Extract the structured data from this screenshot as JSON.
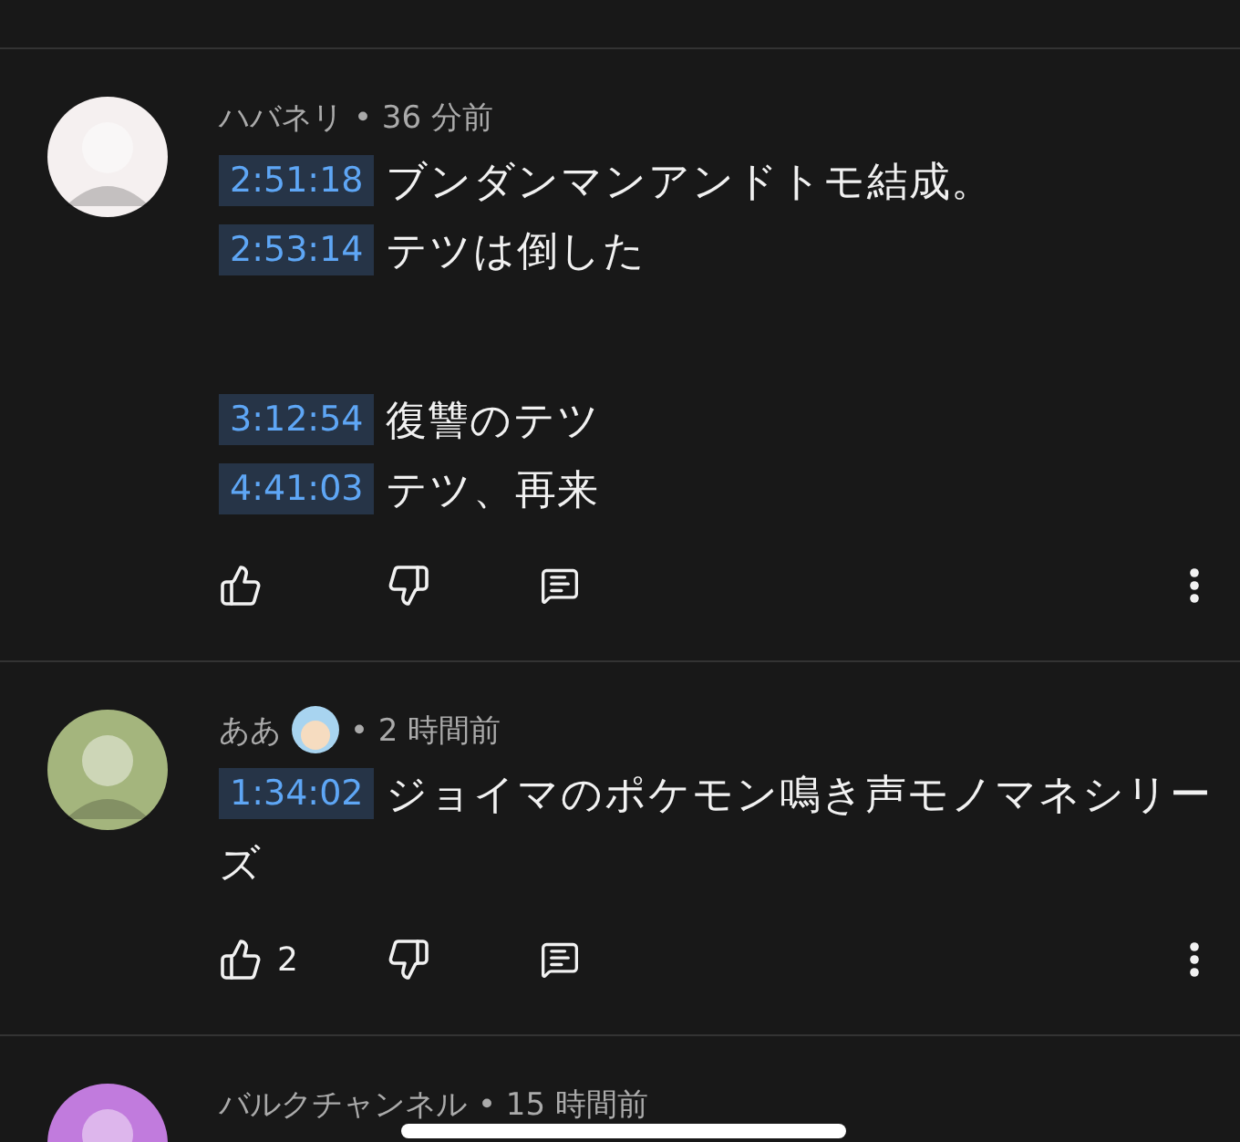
{
  "comments": [
    {
      "author": "ハバネリ",
      "time": "• 36 分前",
      "color": "#f5f0f0",
      "paragraphs": [
        [
          {
            "timestamp": "2:51:18",
            "text": "ブンダンマンアンドトモ結成。"
          },
          {
            "timestamp": "2:53:14",
            "text": "テツは倒した"
          }
        ],
        [
          {
            "timestamp": "3:12:54",
            "text": "復讐のテツ"
          },
          {
            "timestamp": "4:41:03",
            "text": "テツ、再来"
          }
        ]
      ]
    },
    {
      "author": "ああ",
      "time": "• 2 時間前",
      "color": "#a4b57d",
      "has_badge": true,
      "likes": "2",
      "paragraphs": [
        [
          {
            "timestamp": "1:34:02",
            "text": "ジョイマのポケモン鳴き声モノマネシリーズ"
          }
        ]
      ]
    },
    {
      "author": "バルクチャンネル",
      "time": "• 15 時間前",
      "color": "#c17bdd"
    }
  ]
}
